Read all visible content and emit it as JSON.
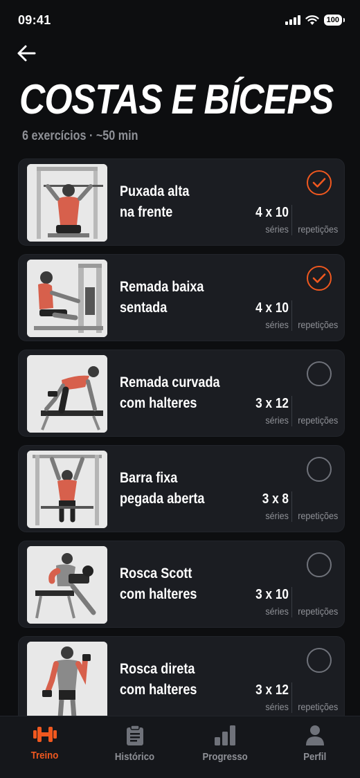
{
  "status": {
    "time": "09:41",
    "battery": "100"
  },
  "header": {
    "title": "COSTAS E BÍCEPS",
    "subtitle": "6 exercícios · ~50 min"
  },
  "exercises": [
    {
      "line1": "Puxada alta",
      "line2": "na frente",
      "sets": "4 x 10",
      "sets_label": "séries",
      "reps_label": "repetições",
      "done": true,
      "thumb": "lat-pulldown"
    },
    {
      "line1": "Remada baixa",
      "line2": "sentada",
      "sets": "4 x 10",
      "sets_label": "séries",
      "reps_label": "repetições",
      "done": true,
      "thumb": "seated-row"
    },
    {
      "line1": "Remada curvada",
      "line2": "com halteres",
      "sets": "3 x 12",
      "sets_label": "séries",
      "reps_label": "repetições",
      "done": false,
      "thumb": "dumbbell-row"
    },
    {
      "line1": "Barra fixa",
      "line2": "pegada aberta",
      "sets": "3 x 8",
      "sets_label": "séries",
      "reps_label": "repetições",
      "done": false,
      "thumb": "pull-up"
    },
    {
      "line1": "Rosca Scott",
      "line2": "com halteres",
      "sets": "3 x 10",
      "sets_label": "séries",
      "reps_label": "repetições",
      "done": false,
      "thumb": "preacher-curl"
    },
    {
      "line1": "Rosca direta",
      "line2": "com halteres",
      "sets": "3 x 12",
      "sets_label": "séries",
      "reps_label": "repetições",
      "done": false,
      "thumb": "dumbbell-curl"
    }
  ],
  "tabs": [
    {
      "label": "Treino",
      "icon": "dumbbell-icon",
      "active": true
    },
    {
      "label": "Histórico",
      "icon": "clipboard-icon",
      "active": false
    },
    {
      "label": "Progresso",
      "icon": "bar-chart-icon",
      "active": false
    },
    {
      "label": "Perfil",
      "icon": "person-icon",
      "active": false
    }
  ],
  "colors": {
    "accent": "#f0581f",
    "background": "#0d0e10",
    "card": "#1b1d22",
    "muted": "#8f9197"
  }
}
